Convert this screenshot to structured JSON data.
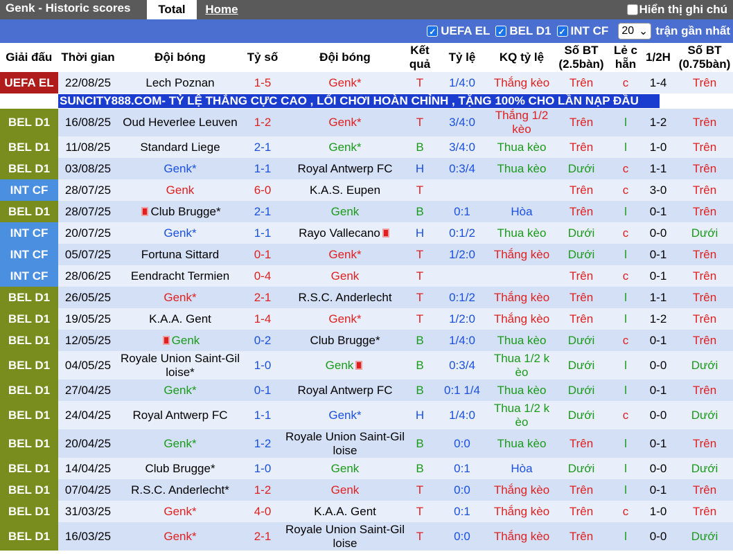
{
  "header": {
    "title": "Genk - Historic scores",
    "tab_total": "Total",
    "tab_home": "Home",
    "notes_label": "Hiển thị ghi chú"
  },
  "filters": {
    "uefa": "UEFA EL",
    "bel": "BEL D1",
    "int": "INT CF",
    "count": "20",
    "suffix": "trận gần nhất"
  },
  "columns": [
    "Giải đấu",
    "Thời gian",
    "Đội bóng",
    "Tỷ số",
    "Đội bóng",
    "Kết quả",
    "Tỷ lệ",
    "KQ tỷ lệ",
    "Số BT (2.5bàn)",
    "Lẻ c hẵn",
    "1/2H",
    "Số BT (0.75bàn)"
  ],
  "colors": {
    "home_color": "#e02020",
    "win": "#e02020",
    "lose": "#1a9a1a",
    "draw": "#1a50e0"
  },
  "ad": "SUNCITY888.COM- TỶ LỆ THẮNG CỰC CAO , LỐI CHƠI HOÀN CHỈNH , TẶNG 100% CHO LẦN NẠP ĐẦU",
  "rows": [
    {
      "comp": "UEFA EL",
      "date": "22/08/25",
      "home": "Lech Poznan",
      "score": "1-5",
      "away": "Genk*",
      "res": "T",
      "odds": "1/4:0",
      "kq": "Thắng kèo",
      "bt": "Trên",
      "lc": "c",
      "half": "1-4",
      "bt2": "Trên"
    },
    {
      "comp": "BEL D1",
      "date": "16/08/25",
      "home": "Oud Heverlee Leuven",
      "score": "1-2",
      "away": "Genk*",
      "res": "T",
      "odds": "3/4:0",
      "kq": "Thắng 1/2 kèo",
      "bt": "Trên",
      "lc": "l",
      "half": "1-2",
      "bt2": "Trên"
    },
    {
      "comp": "BEL D1",
      "date": "11/08/25",
      "home": "Standard Liege",
      "score": "2-1",
      "away": "Genk*",
      "res": "B",
      "odds": "3/4:0",
      "kq": "Thua kèo",
      "bt": "Trên",
      "lc": "l",
      "half": "1-0",
      "bt2": "Trên"
    },
    {
      "comp": "BEL D1",
      "date": "03/08/25",
      "home": "Genk*",
      "score": "1-1",
      "away": "Royal Antwerp FC",
      "res": "H",
      "odds": "0:3/4",
      "kq": "Thua kèo",
      "bt": "Dưới",
      "lc": "c",
      "half": "1-1",
      "bt2": "Trên"
    },
    {
      "comp": "INT CF",
      "date": "28/07/25",
      "home": "Genk",
      "score": "6-0",
      "away": "K.A.S. Eupen",
      "res": "T",
      "odds": "",
      "kq": "",
      "bt": "Trên",
      "lc": "c",
      "half": "3-0",
      "bt2": "Trên"
    },
    {
      "comp": "BEL D1",
      "date": "28/07/25",
      "home": "Club Brugge*",
      "score": "2-1",
      "away": "Genk",
      "res": "B",
      "odds": "0:1",
      "kq": "Hòa",
      "bt": "Trên",
      "lc": "l",
      "half": "0-1",
      "bt2": "Trên"
    },
    {
      "comp": "INT CF",
      "date": "20/07/25",
      "home": "Genk*",
      "score": "1-1",
      "away": "Rayo Vallecano",
      "res": "H",
      "odds": "0:1/2",
      "kq": "Thua kèo",
      "bt": "Dưới",
      "lc": "c",
      "half": "0-0",
      "bt2": "Dưới"
    },
    {
      "comp": "INT CF",
      "date": "05/07/25",
      "home": "Fortuna Sittard",
      "score": "0-1",
      "away": "Genk*",
      "res": "T",
      "odds": "1/2:0",
      "kq": "Thắng kèo",
      "bt": "Dưới",
      "lc": "l",
      "half": "0-1",
      "bt2": "Trên"
    },
    {
      "comp": "INT CF",
      "date": "28/06/25",
      "home": "Eendracht Termien",
      "score": "0-4",
      "away": "Genk",
      "res": "T",
      "odds": "",
      "kq": "",
      "bt": "Trên",
      "lc": "c",
      "half": "0-1",
      "bt2": "Trên"
    },
    {
      "comp": "BEL D1",
      "date": "26/05/25",
      "home": "Genk*",
      "score": "2-1",
      "away": "R.S.C. Anderlecht",
      "res": "T",
      "odds": "0:1/2",
      "kq": "Thắng kèo",
      "bt": "Trên",
      "lc": "l",
      "half": "1-1",
      "bt2": "Trên"
    },
    {
      "comp": "BEL D1",
      "date": "19/05/25",
      "home": "K.A.A. Gent",
      "score": "1-4",
      "away": "Genk*",
      "res": "T",
      "odds": "1/2:0",
      "kq": "Thắng kèo",
      "bt": "Trên",
      "lc": "l",
      "half": "1-2",
      "bt2": "Trên"
    },
    {
      "comp": "BEL D1",
      "date": "12/05/25",
      "home": "Genk",
      "score": "0-2",
      "away": "Club Brugge*",
      "res": "B",
      "odds": "1/4:0",
      "kq": "Thua kèo",
      "bt": "Dưới",
      "lc": "c",
      "half": "0-1",
      "bt2": "Trên"
    },
    {
      "comp": "BEL D1",
      "date": "04/05/25",
      "home": "Royale Union Saint-Gil loise*",
      "score": "1-0",
      "away": "Genk",
      "res": "B",
      "odds": "0:3/4",
      "kq": "Thua 1/2 k èo",
      "bt": "Dưới",
      "lc": "l",
      "half": "0-0",
      "bt2": "Dưới"
    },
    {
      "comp": "BEL D1",
      "date": "27/04/25",
      "home": "Genk*",
      "score": "0-1",
      "away": "Royal Antwerp FC",
      "res": "B",
      "odds": "0:1 1/4",
      "kq": "Thua kèo",
      "bt": "Dưới",
      "lc": "l",
      "half": "0-1",
      "bt2": "Trên"
    },
    {
      "comp": "BEL D1",
      "date": "24/04/25",
      "home": "Royal Antwerp FC",
      "score": "1-1",
      "away": "Genk*",
      "res": "H",
      "odds": "1/4:0",
      "kq": "Thua 1/2 k èo",
      "bt": "Dưới",
      "lc": "c",
      "half": "0-0",
      "bt2": "Dưới"
    },
    {
      "comp": "BEL D1",
      "date": "20/04/25",
      "home": "Genk*",
      "score": "1-2",
      "away": "Royale Union Saint-Gil loise",
      "res": "B",
      "odds": "0:0",
      "kq": "Thua kèo",
      "bt": "Trên",
      "lc": "l",
      "half": "0-1",
      "bt2": "Trên"
    },
    {
      "comp": "BEL D1",
      "date": "14/04/25",
      "home": "Club Brugge*",
      "score": "1-0",
      "away": "Genk",
      "res": "B",
      "odds": "0:1",
      "kq": "Hòa",
      "bt": "Dưới",
      "lc": "l",
      "half": "0-0",
      "bt2": "Dưới"
    },
    {
      "comp": "BEL D1",
      "date": "07/04/25",
      "home": "R.S.C. Anderlecht*",
      "score": "1-2",
      "away": "Genk",
      "res": "T",
      "odds": "0:0",
      "kq": "Thắng kèo",
      "bt": "Trên",
      "lc": "l",
      "half": "0-1",
      "bt2": "Trên"
    },
    {
      "comp": "BEL D1",
      "date": "31/03/25",
      "home": "Genk*",
      "score": "4-0",
      "away": "K.A.A. Gent",
      "res": "T",
      "odds": "0:1",
      "kq": "Thắng kèo",
      "bt": "Trên",
      "lc": "c",
      "half": "1-0",
      "bt2": "Trên"
    },
    {
      "comp": "BEL D1",
      "date": "16/03/25",
      "home": "Genk*",
      "score": "2-1",
      "away": "Royale Union Saint-Gil loise",
      "res": "T",
      "odds": "0:0",
      "kq": "Thắng kèo",
      "bt": "Trên",
      "lc": "l",
      "half": "0-0",
      "bt2": "Dưới"
    }
  ]
}
